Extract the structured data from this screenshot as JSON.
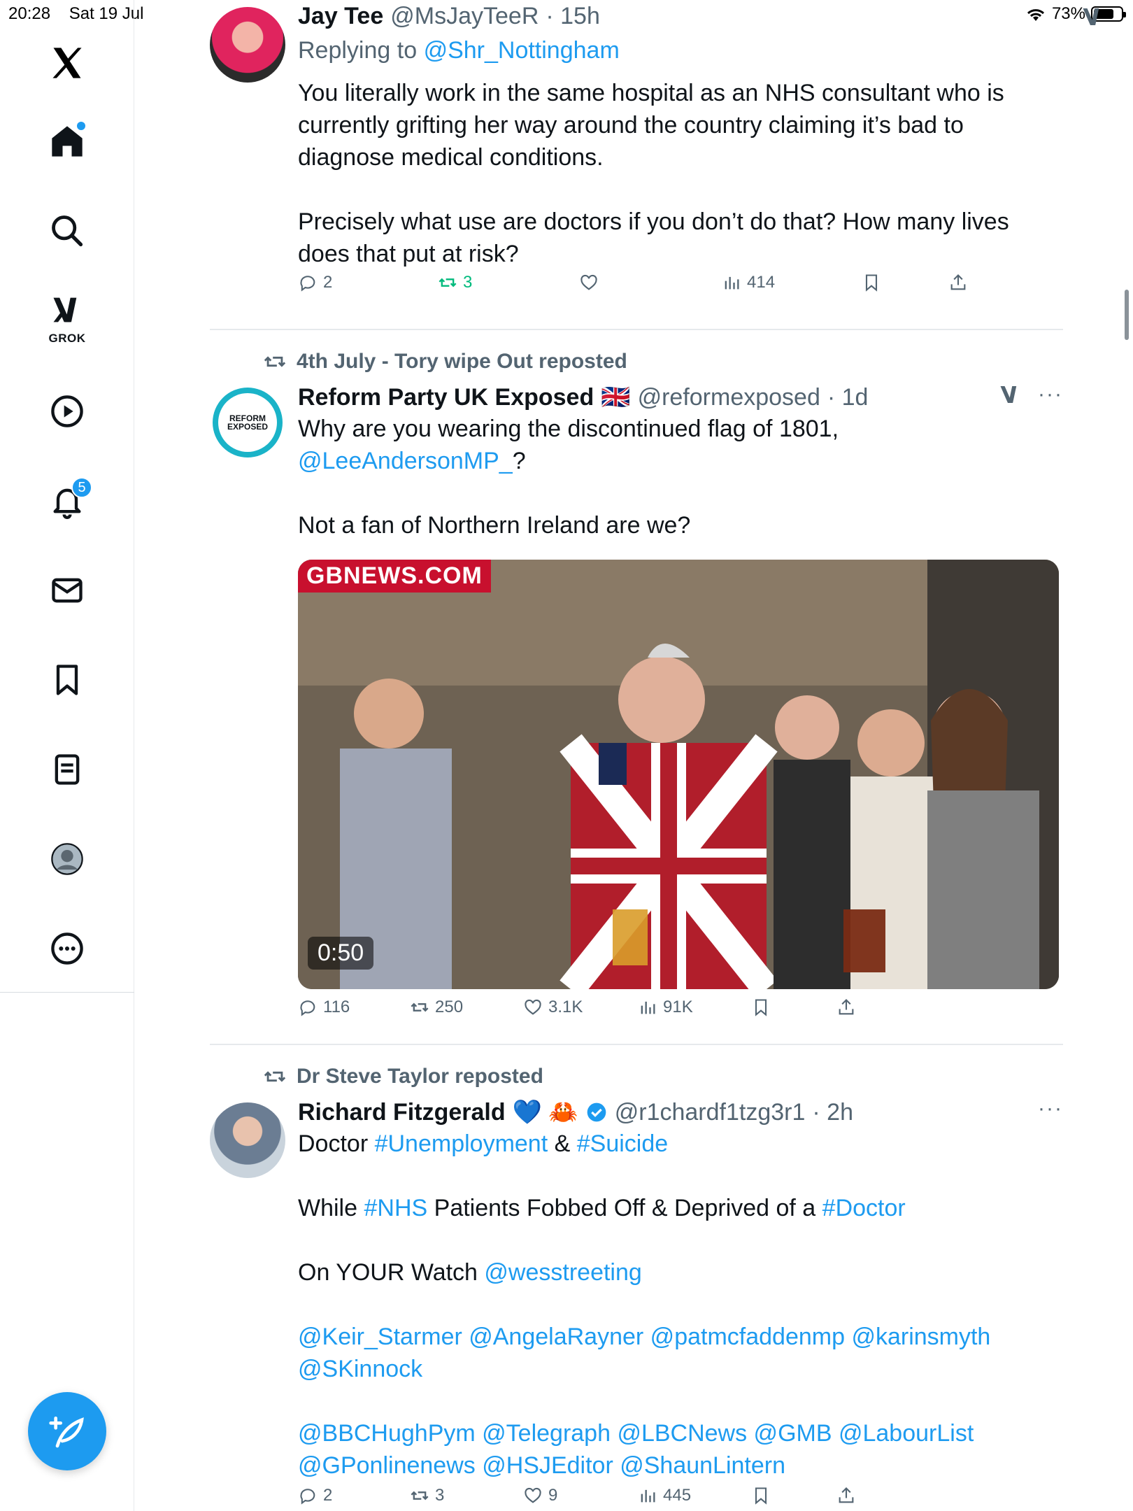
{
  "status": {
    "time": "20:28",
    "date": "Sat 19 Jul",
    "battery": "73%"
  },
  "sidebar": {
    "grok_label": "GROK",
    "notifications_badge": "5"
  },
  "tweets": [
    {
      "name": "Jay Tee",
      "handle": "@MsJayTeeR",
      "time": "· 15h",
      "replying_prefix": "Replying to",
      "replying_to": "@Shr_Nottingham",
      "lines": [
        "You literally work in the same hospital as an NHS consultant who is",
        "currently grifting her way around the country claiming it’s bad to",
        "diagnose medical conditions.",
        "Precisely what use are doctors if you don’t do that? How many lives",
        "does that put at risk?"
      ],
      "stats": {
        "replies": "2",
        "reposts": "3",
        "likes": "",
        "views": "414"
      }
    },
    {
      "repost_by": "4th July - Tory wipe Out reposted",
      "name": "Reform Party UK Exposed",
      "flag": "🇬🇧",
      "handle": "@reformexposed",
      "time": "· 1d",
      "avatar_text": "REFORM EXPOSED",
      "line1": "Why are you wearing the discontinued flag of 1801,",
      "mention": "@LeeAndersonMP_",
      "mention_suffix": "?",
      "line3": "Not a fan of Northern Ireland are we?",
      "media_tag": "GBNEWS.COM",
      "media_duration": "0:50",
      "stats": {
        "replies": "116",
        "reposts": "250",
        "likes": "3.1K",
        "views": "91K"
      }
    },
    {
      "repost_by": "Dr Steve Taylor reposted",
      "name": "Richard Fitzgerald",
      "emoji": "💙 🦀",
      "handle": "@r1chardf1tzg3r1",
      "time": "· 2h",
      "l1_text": "Doctor",
      "l1_tag1": "#Unemployment",
      "l1_amp": "&",
      "l1_tag2": "#Suicide",
      "l2_text1": "While",
      "l2_tag1": "#NHS",
      "l2_text2": "Patients Fobbed Off & Deprived of a",
      "l2_tag2": "#Doctor",
      "l3_text": "On YOUR Watch",
      "l3_mention": "@wesstreeting",
      "mentions_a1": "@Keir_Starmer @AngelaRayner @patmcfaddenmp @karinsmyth",
      "mentions_a2": "@SKinnock",
      "mentions_b1": "@BBCHughPym @Telegraph @LBCNews @GMB @LabourList",
      "mentions_b2": "@GPonlinenews @HSJEditor @ShaunLintern",
      "stats": {
        "replies": "2",
        "reposts": "3",
        "likes": "9",
        "views": "445"
      }
    }
  ],
  "colors": {
    "link": "#1d9bf0",
    "repost_active": "#00ba7c",
    "muted": "#536471"
  }
}
